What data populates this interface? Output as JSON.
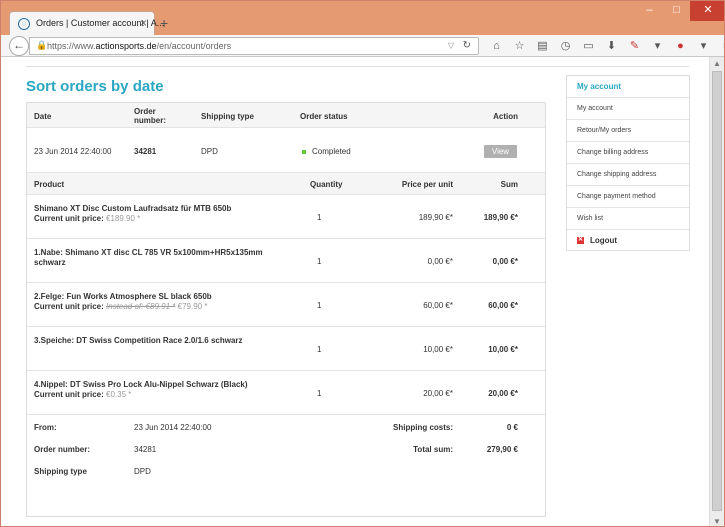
{
  "browser": {
    "tab_title": "Orders | Customer account | A...",
    "url_scheme": "https://www.",
    "url_domain": "actionsports.de",
    "url_path": "/en/account/orders",
    "toolbar_icons": [
      "home-icon",
      "star-icon",
      "clipboard-icon",
      "history-icon",
      "window-icon",
      "download-icon",
      "tools-icon",
      "dropdown-icon",
      "adblock-icon",
      "dropdown-icon",
      "menu-icon"
    ]
  },
  "page": {
    "title": "Sort orders by date"
  },
  "order_header": {
    "date": "Date",
    "order_number": "Order number:",
    "shipping_type": "Shipping type",
    "order_status": "Order status",
    "action": "Action"
  },
  "order": {
    "date": "23 Jun 2014 22:40:00",
    "number": "34281",
    "shipping": "DPD",
    "status": "Completed",
    "view_label": "View"
  },
  "item_header": {
    "product": "Product",
    "quantity": "Quantity",
    "price_per_unit": "Price per unit",
    "sum": "Sum"
  },
  "items": [
    {
      "name": "Shimano XT Disc Custom Laufradsatz für MTB 650b",
      "unit_label": "Current unit price:",
      "unit_value": "€189.90 *",
      "quantity": "1",
      "price": "189,90 €*",
      "sum": "189,90 €*"
    },
    {
      "name": "1.Nabe: Shimano XT disc CL 785 VR 5x100mm+HR5x135mm schwarz",
      "quantity": "1",
      "price": "0,00 €*",
      "sum": "0,00 €*"
    },
    {
      "name": "2.Felge: Fun Works Atmosphere SL black 650b",
      "unit_label": "Current unit price:",
      "instead_of": "Instead of: €89.91 *",
      "unit_value": "€79.90 *",
      "quantity": "1",
      "price": "60,00 €*",
      "sum": "60,00 €*"
    },
    {
      "name": "3.Speiche: DT Swiss Competition Race 2.0/1.6 schwarz",
      "quantity": "1",
      "price": "10,00 €*",
      "sum": "10,00 €*"
    },
    {
      "name": "4.Nippel: DT Swiss Pro Lock Alu-Nippel Schwarz (Black)",
      "unit_label": "Current unit price:",
      "unit_value": "€0.35 *",
      "quantity": "1",
      "price": "20,00 €*",
      "sum": "20,00 €*"
    }
  ],
  "summary": {
    "from_label": "From:",
    "from_value": "23 Jun 2014 22:40:00",
    "order_number_label": "Order number:",
    "order_number_value": "34281",
    "shipping_type_label": "Shipping type",
    "shipping_type_value": "DPD",
    "shipping_costs_label": "Shipping costs:",
    "shipping_costs_value": "0 €",
    "total_label": "Total sum:",
    "total_value": "279,90 €"
  },
  "sidebar": {
    "heading": "My account",
    "items": [
      "My account",
      "Retour/My orders",
      "Change billing address",
      "Change shipping address",
      "Change payment method",
      "Wish list"
    ],
    "logout": "Logout"
  },
  "colors": {
    "accent": "#2aa7c2",
    "status_completed": "#66cc33",
    "titlebar": "#e59a72"
  }
}
